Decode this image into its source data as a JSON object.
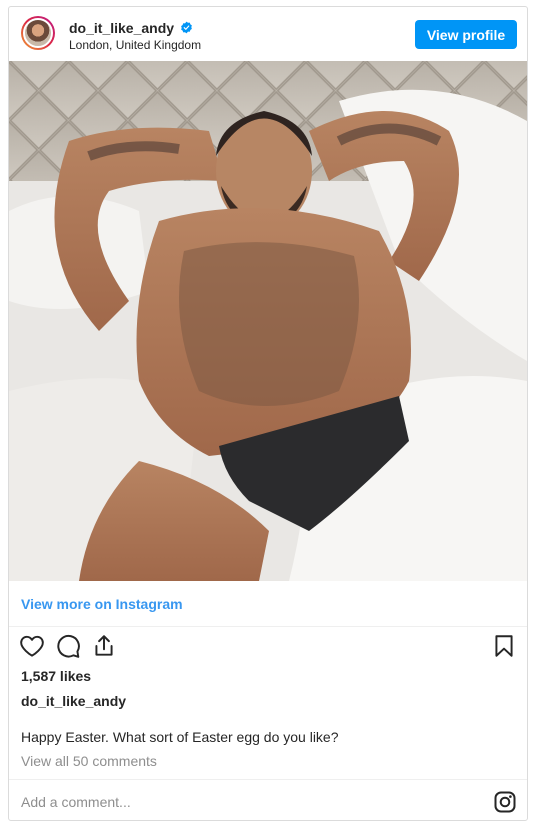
{
  "post": {
    "username": "do_it_like_andy",
    "location": "London, United Kingdom",
    "verified": true,
    "view_profile_label": "View profile",
    "view_more_label": "View more on Instagram",
    "likes": "1,587 likes",
    "caption_username": "do_it_like_andy",
    "caption": "Happy Easter. What sort of Easter egg do you like?",
    "view_comments": "View all 50 comments",
    "comment_placeholder": "Add a comment..."
  },
  "icons": {
    "avatar": "avatar",
    "verified": "verified-badge-icon",
    "like": "heart-icon",
    "comment": "comment-icon",
    "share": "share-icon",
    "save": "bookmark-icon",
    "brand": "instagram-icon"
  },
  "colors": {
    "accent": "#0095f6",
    "link": "#3897f0",
    "text": "#262626",
    "muted": "#8e8e8e",
    "border": "#dbdbdb"
  }
}
